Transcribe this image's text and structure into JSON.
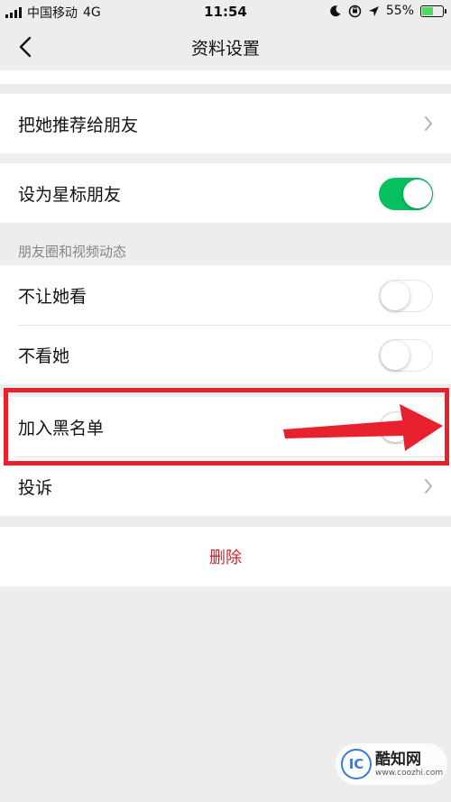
{
  "status_bar": {
    "carrier": "中国移动",
    "network": "4G",
    "time": "11:54",
    "battery_percent": "55%",
    "battery_level": 0.55,
    "icons": [
      "signal-icon",
      "moon-icon",
      "orientation-lock-icon",
      "location-icon",
      "battery-icon"
    ]
  },
  "nav": {
    "title": "资料设置",
    "back_icon": "chevron-left-icon"
  },
  "groups": {
    "recommend": {
      "label": "把她推荐给朋友"
    },
    "star": {
      "label": "设为星标朋友",
      "toggle_on": true
    },
    "moments": {
      "header": "朋友圈和视频动态",
      "hide_my_posts": {
        "label": "不让她看",
        "toggle_on": false
      },
      "hide_her_posts": {
        "label": "不看她",
        "toggle_on": false
      }
    },
    "privacy": {
      "blacklist": {
        "label": "加入黑名单",
        "toggle_on": false
      },
      "report": {
        "label": "投诉"
      }
    },
    "delete": {
      "label": "删除"
    }
  },
  "annotation": {
    "color": "#E8212E"
  },
  "watermark": {
    "logo_text": "IC",
    "name": "酷知网",
    "url": "www.coozhi.com"
  },
  "colors": {
    "toggle_on": "#07C160",
    "delete_text": "#C9262F",
    "background": "#EDEDED"
  }
}
